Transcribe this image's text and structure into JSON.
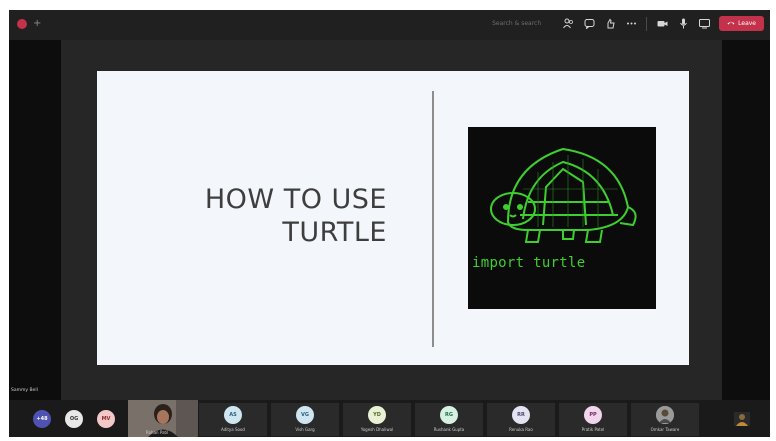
{
  "toolbar": {
    "search_hint": "Search & search",
    "leave_label": "Leave",
    "icons": [
      "people-icon",
      "chat-icon",
      "reactions-icon",
      "more-icon",
      "camera-icon",
      "mic-icon",
      "share-icon"
    ]
  },
  "slide": {
    "title_line1": "HOW TO USE",
    "title_line2": "TURTLE",
    "image_caption": "import turtle"
  },
  "presenter": {
    "name": "Sammy Bell"
  },
  "participants": [
    {
      "initials": "+48",
      "label": "",
      "color": "#4f52b2",
      "text": "#ffffff"
    },
    {
      "initials": "OG",
      "label": "",
      "color": "#e8e8e8",
      "text": "#333333"
    },
    {
      "initials": "MV",
      "label": "",
      "color": "#f3c8c8",
      "text": "#8a2b2b"
    },
    {
      "initials": "",
      "label": "Rohan Patil",
      "video": true
    },
    {
      "initials": "AS",
      "label": "Aditya Sood",
      "color": "#cfe6f1",
      "text": "#2b5e76"
    },
    {
      "initials": "VG",
      "label": "Vish Garg",
      "color": "#cfe6f1",
      "text": "#2b5e76"
    },
    {
      "initials": "YD",
      "label": "Yogesh Dhaliwal",
      "color": "#e9f1d5",
      "text": "#5a6b2b"
    },
    {
      "initials": "RG",
      "label": "Rushank Gupta",
      "color": "#d5f1e3",
      "text": "#2b6b4a"
    },
    {
      "initials": "RR",
      "label": "Renuka Rao",
      "color": "#e3e3f1",
      "text": "#4a4a6b"
    },
    {
      "initials": "PP",
      "label": "Pratik Patel",
      "color": "#f1d5ec",
      "text": "#6b2b5e"
    },
    {
      "initials": "",
      "label": "Omkar Taware",
      "photo": true
    }
  ],
  "colors": {
    "leave": "#c4314b",
    "turtle_green": "#3fce2f",
    "slide_bg": "#f3f6fb"
  }
}
